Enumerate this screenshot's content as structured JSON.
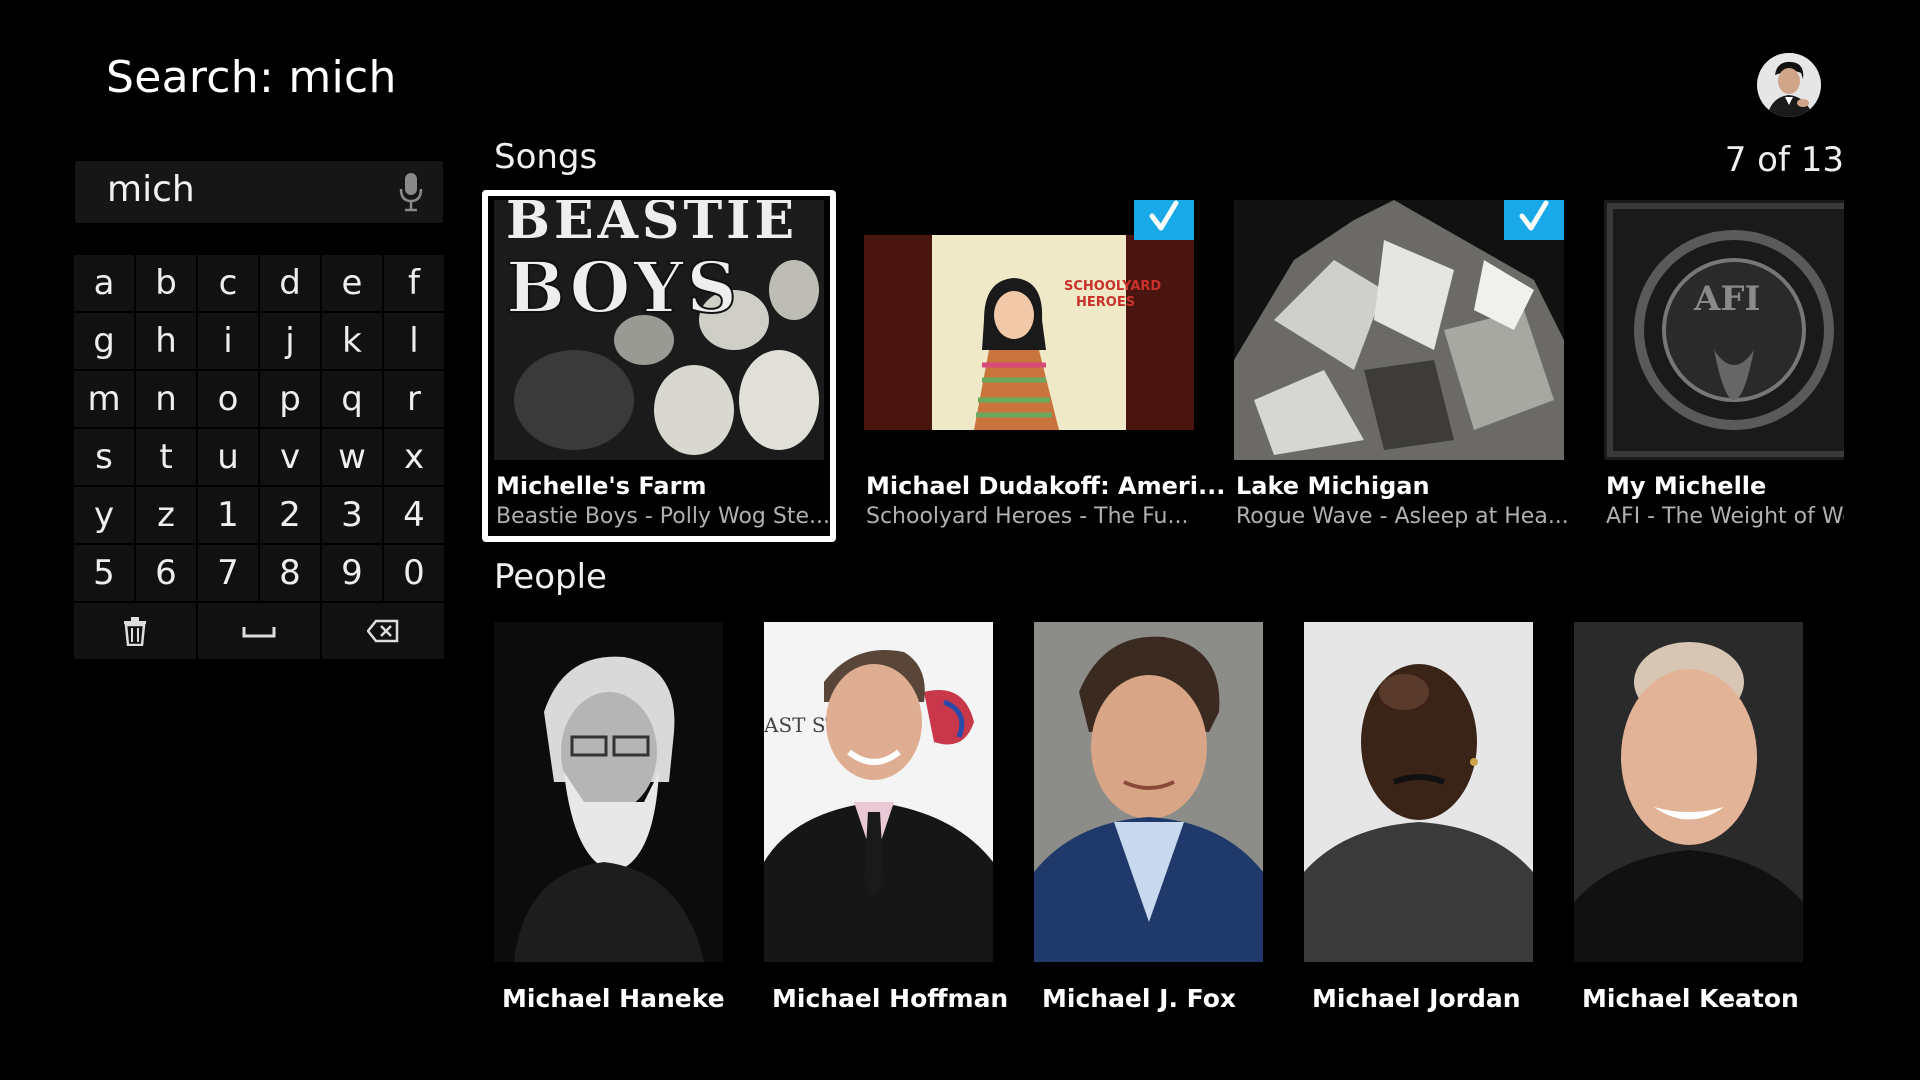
{
  "header": {
    "title": "Search: mich"
  },
  "search": {
    "value": "mich"
  },
  "keyboard": {
    "keys": [
      "a",
      "b",
      "c",
      "d",
      "e",
      "f",
      "g",
      "h",
      "i",
      "j",
      "k",
      "l",
      "m",
      "n",
      "o",
      "p",
      "q",
      "r",
      "s",
      "t",
      "u",
      "v",
      "w",
      "x",
      "y",
      "z",
      "1",
      "2",
      "3",
      "4",
      "5",
      "6",
      "7",
      "8",
      "9",
      "0"
    ],
    "actions": [
      {
        "name": "clear-key",
        "icon": "trash-icon"
      },
      {
        "name": "space-key",
        "icon": "space-icon"
      },
      {
        "name": "backspace-key",
        "icon": "backspace-icon"
      }
    ]
  },
  "songs": {
    "heading": "Songs",
    "counter": "7 of 13",
    "items": [
      {
        "title": "Michelle's Farm",
        "subtitle": "Beastie Boys - Polly Wog Ste...",
        "checked": false,
        "focused": true,
        "art_text": "BEASTIE BOYS"
      },
      {
        "title": "Michael Dudakoff: Ameri...",
        "subtitle": "Schoolyard Heroes - The Fu...",
        "checked": true,
        "focused": false,
        "art_text": "SCHOOLYARD HEROES"
      },
      {
        "title": "Lake Michigan",
        "subtitle": "Rogue Wave - Asleep at Hea...",
        "checked": true,
        "focused": false,
        "art_text": ""
      },
      {
        "title": "My Michelle",
        "subtitle": "AFI - The Weight of Wo",
        "checked": false,
        "focused": false,
        "art_text": "AFI"
      }
    ]
  },
  "people": {
    "heading": "People",
    "items": [
      {
        "name": "Michael Haneke"
      },
      {
        "name": "Michael Hoffman"
      },
      {
        "name": "Michael J. Fox"
      },
      {
        "name": "Michael Jordan"
      },
      {
        "name": "Michael Keaton"
      }
    ]
  },
  "colors": {
    "background": "#000000",
    "accent": "#19a8e8",
    "key_bg": "#111111"
  }
}
